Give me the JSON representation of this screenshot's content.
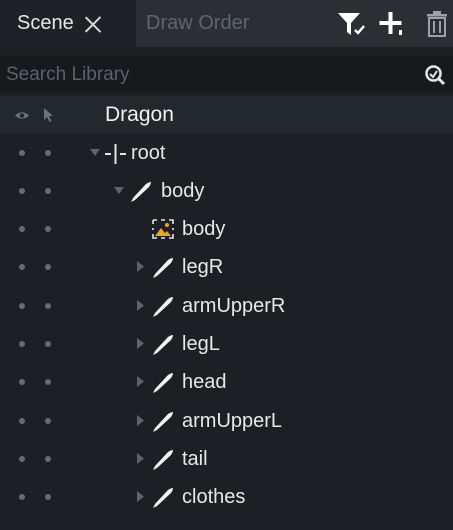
{
  "tabs": {
    "active": "Scene",
    "inactive": "Draw Order"
  },
  "search": {
    "placeholder": "Search Library",
    "value": ""
  },
  "tree": {
    "skeleton": "Dragon",
    "root": "root",
    "body_bone": "body",
    "body_attachment": "body",
    "children": [
      "legR",
      "armUpperR",
      "legL",
      "head",
      "armUpperL",
      "tail",
      "clothes"
    ]
  },
  "colors": {
    "accent": "#e8a52a",
    "panel_bg": "#1c1f23",
    "tab_bar_bg": "#2b2f34"
  },
  "icons": [
    "close-icon",
    "filter-icon",
    "add-icon",
    "trash-icon",
    "search-icon",
    "eye-icon",
    "cursor-icon",
    "root-icon",
    "bone-icon",
    "image-icon",
    "chevron-right-icon",
    "chevron-down-icon"
  ]
}
